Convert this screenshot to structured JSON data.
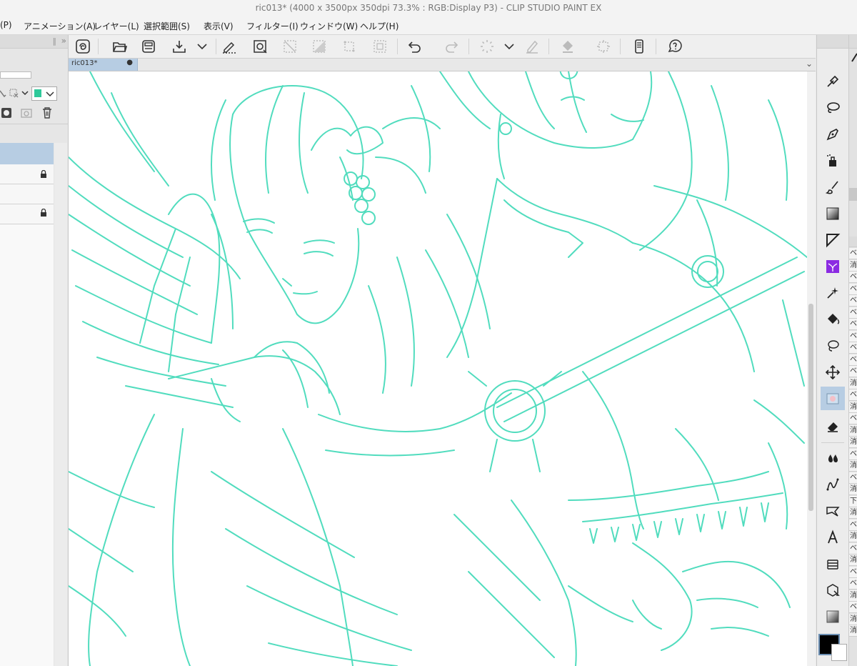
{
  "window": {
    "title": "ric013* (4000 x 3500px 350dpi 73.3% : RGB:Display P3)  - CLIP STUDIO PAINT EX"
  },
  "menu": [
    "(P)",
    "アニメーション(A)",
    "レイヤー(L)",
    "選択範囲(S)",
    "表示(V)",
    "フィルター(I)",
    "ウィンドウ(W)",
    "ヘルプ(H)"
  ],
  "toolbar": {
    "icons": [
      "clip-studio-icon",
      "open-folder-icon",
      "save-icon",
      "export-icon",
      "chevron-down-icon",
      "pen-select-icon",
      "transform-icon",
      "deselect-icon",
      "invert-selection-icon",
      "expand-selection-icon",
      "selection-border-icon",
      "undo-icon",
      "redo-icon",
      "loading-icon",
      "chevron-down-icon",
      "clear-layer-icon",
      "fill-icon",
      "scale-icon",
      "smartphone-icon",
      "help-icon"
    ]
  },
  "document": {
    "tab_label": "ric013*",
    "tab_dot": "●"
  },
  "tools": [
    "pen-icon",
    "eyedropper-icon",
    "lasso-icon",
    "pen-nib-icon",
    "airbrush-icon",
    "brush-icon",
    "gradient-icon",
    "figure-ruler-icon",
    "decoration-icon",
    "sparkle-icon",
    "fill-bucket-icon",
    "lasso-select-icon",
    "move-icon",
    "blend-icon",
    "eraser-icon",
    "blur-icon",
    "vector-icon",
    "balloon-icon",
    "text-icon",
    "frame-icon",
    "object-icon",
    "gradient-square-icon"
  ],
  "colors": {
    "sketch": "#3fd9b7",
    "accent_tab": "#b7cde3",
    "main_color": "#000000",
    "sub_color": "#ffffff",
    "layer_color_swatch": "#2fc99a"
  },
  "layer_panel": {
    "sub_cells": [
      "ベ",
      "消",
      "ベ",
      "ベ",
      "ベ",
      "ベ",
      "ベ",
      "ベ",
      "ベ",
      "ベ",
      "ベ",
      "消",
      "ベ",
      "消",
      "ベ",
      "消",
      "消",
      "ベ",
      "消",
      "ベ",
      "消",
      "下",
      "消",
      "ベ",
      "消",
      "ベ",
      "消",
      "ベ",
      "ベ",
      "消",
      "ベ",
      "消",
      "消"
    ]
  }
}
